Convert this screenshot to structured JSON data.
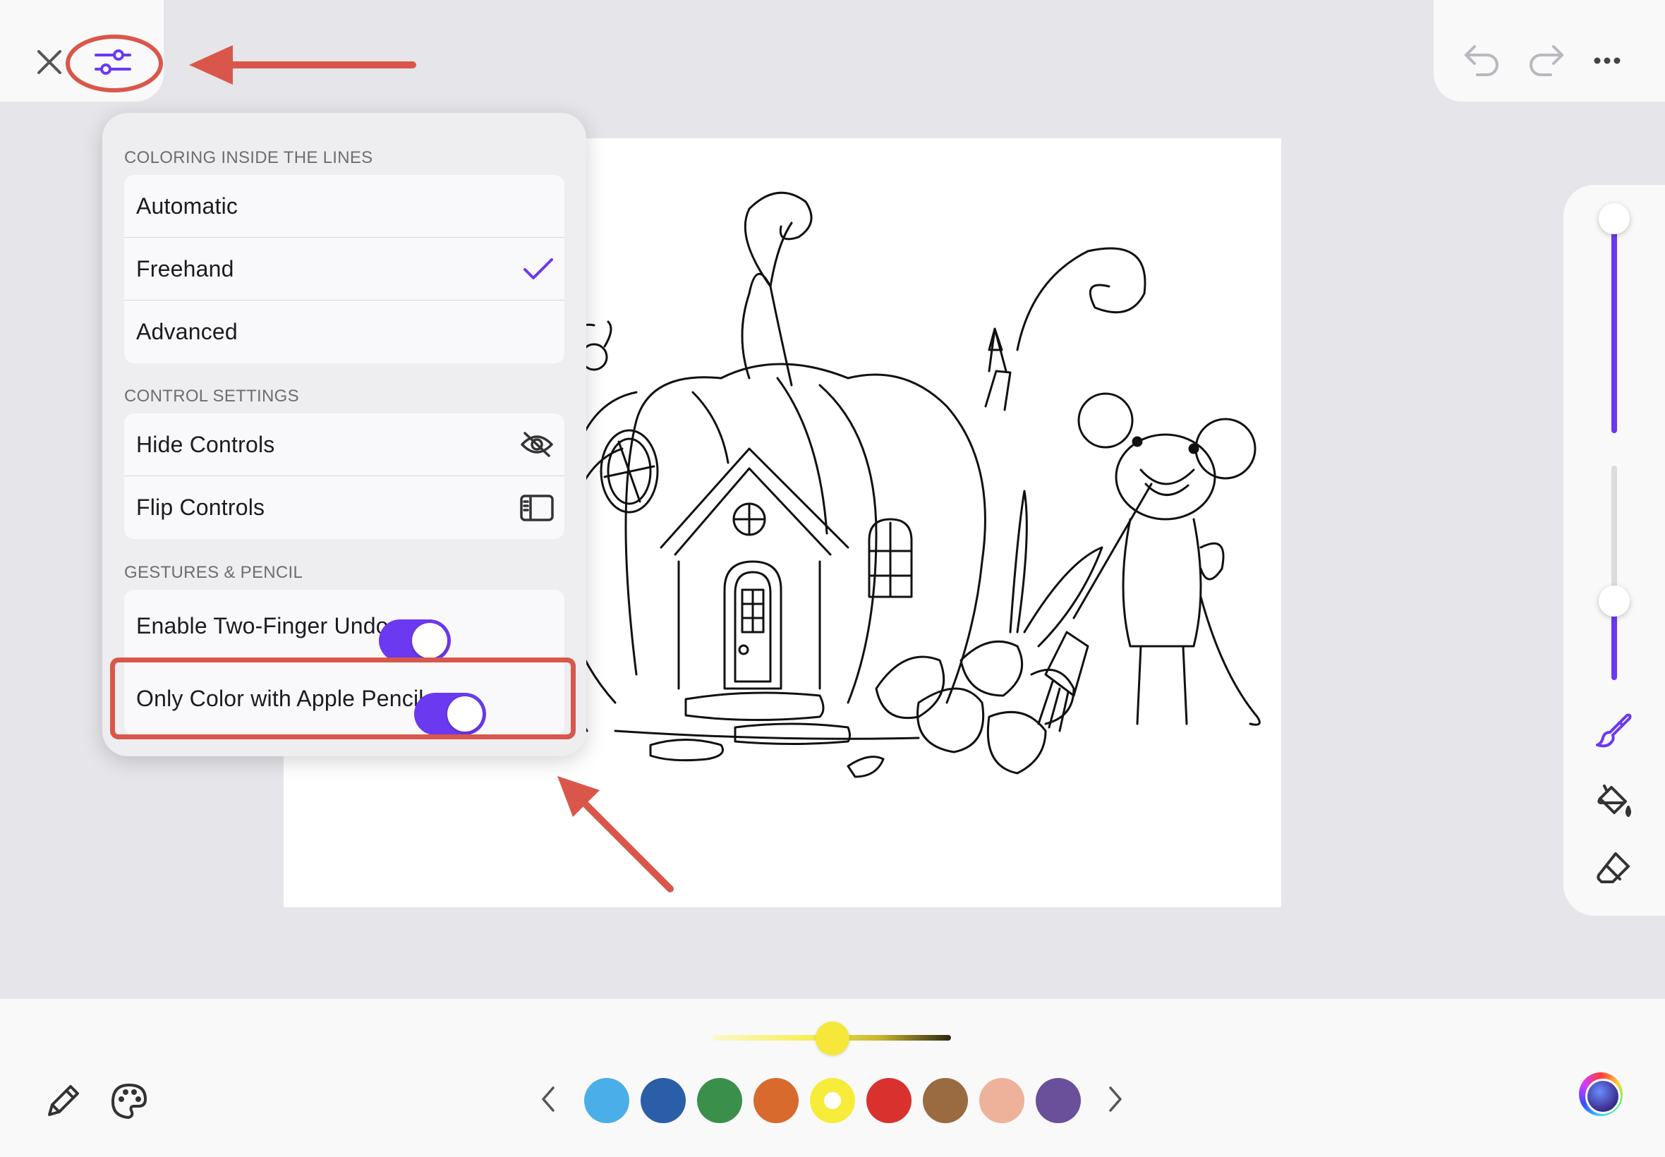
{
  "toolbar": {
    "close_icon": "close-icon",
    "settings_icon": "sliders-icon",
    "undo_icon": "undo-icon",
    "redo_icon": "redo-icon",
    "more_icon": "more-icon"
  },
  "settings_popover": {
    "sections": [
      {
        "header": "COLORING INSIDE THE LINES",
        "items": [
          {
            "label": "Automatic"
          },
          {
            "label": "Freehand",
            "selected": true
          },
          {
            "label": "Advanced"
          }
        ]
      },
      {
        "header": "CONTROL SETTINGS",
        "items": [
          {
            "label": "Hide Controls",
            "icon": "eye-slash-icon"
          },
          {
            "label": "Flip Controls",
            "icon": "sidebar-icon"
          }
        ]
      },
      {
        "header": "GESTURES & PENCIL",
        "items": [
          {
            "label": "Enable Two-Finger Undo",
            "toggle": true
          },
          {
            "label": "Only Color with Apple Pencil",
            "toggle": true
          }
        ]
      }
    ]
  },
  "tool_rail": {
    "size_slider_level": 1.0,
    "opacity_slider_level": 0.39,
    "tools": [
      "brush-icon",
      "paint-bucket-icon",
      "eraser-icon"
    ],
    "active_tool": "brush-icon"
  },
  "bottom_bar": {
    "left_tools": [
      "pencil-icon",
      "palette-icon"
    ],
    "shade_slider_level": 0.52,
    "swatches": [
      "#4aaee8",
      "#2a5ea8",
      "#3a8f4a",
      "#d86a2e",
      "#f7ec3a",
      "#d9312e",
      "#9a6a40",
      "#eeb29a",
      "#6a4f9a"
    ],
    "selected_swatch": 4,
    "prev_icon": "chevron-left-icon",
    "next_icon": "chevron-right-icon",
    "color_picker_icon": "color-wheel-icon"
  },
  "colors": {
    "accent": "#6b39f0",
    "annotation_red": "#d9574a",
    "background": "#e6e5ea"
  }
}
